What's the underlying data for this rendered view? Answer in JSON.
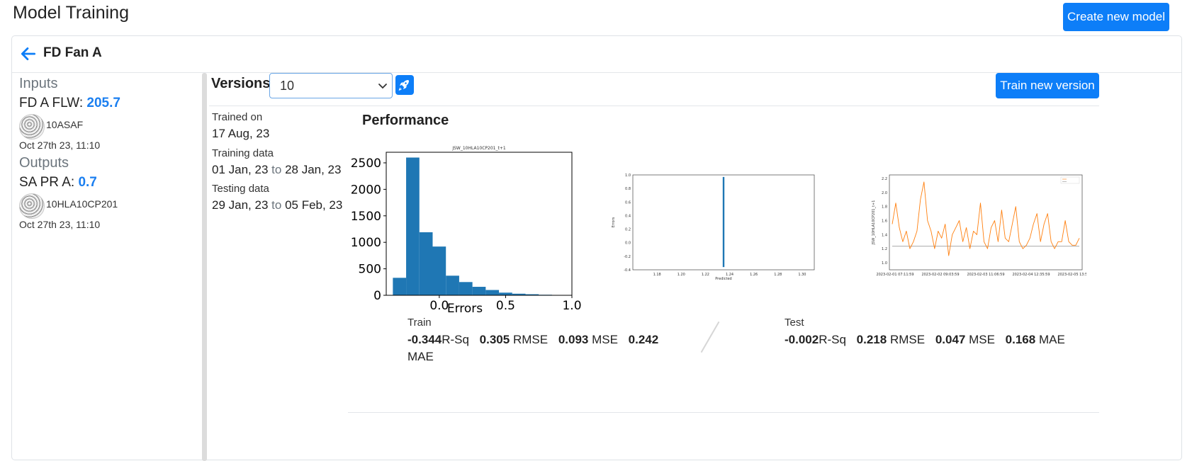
{
  "page": {
    "title": "Model Training",
    "create_button": "Create new model"
  },
  "model": {
    "name": "FD Fan A"
  },
  "inputs": {
    "section_title": "Inputs",
    "label": "FD A FLW:",
    "value": "205.7",
    "tag": "10ASAF",
    "timestamp": "Oct 27th 23, 11:10"
  },
  "outputs": {
    "section_title": "Outputs",
    "label": "SA PR A:",
    "value": "0.7",
    "tag": "10HLA10CP201",
    "timestamp": "Oct 27th 23, 11:10"
  },
  "versions": {
    "label": "Versions :",
    "selected": "10",
    "train_button": "Train new version"
  },
  "details": {
    "trained_on_label": "Trained on",
    "trained_on_value": "17 Aug, 23",
    "training_label": "Training data",
    "training_from": "01 Jan, 23",
    "training_to": "28 Jan, 23",
    "testing_label": "Testing data",
    "testing_from": "29 Jan, 23",
    "testing_to": "05 Feb, 23",
    "to_word": "to"
  },
  "performance": {
    "title": "Performance",
    "train": {
      "title": "Train",
      "rsq": "-0.344",
      "rsq_label": "R-Sq",
      "rmse": "0.305",
      "rmse_label": "RMSE",
      "mse": "0.093",
      "mse_label": "MSE",
      "mae": "0.242",
      "mae_label": "MAE"
    },
    "test": {
      "title": "Test",
      "rsq": "-0.002",
      "rsq_label": "R-Sq",
      "rmse": "0.218",
      "rmse_label": "RMSE",
      "mse": "0.047",
      "mse_label": "MSE",
      "mae": "0.168",
      "mae_label": "MAE"
    }
  },
  "chart_data": [
    {
      "type": "bar",
      "title": "JSW_10HLA10CP201_t+1",
      "xlabel": "Errors",
      "ylabel": "",
      "bin_edges": [
        -0.35,
        -0.25,
        -0.15,
        -0.05,
        0.05,
        0.15,
        0.25,
        0.35,
        0.45,
        0.55,
        0.65,
        0.75,
        0.85,
        0.95
      ],
      "values": [
        330,
        2600,
        1190,
        920,
        370,
        250,
        160,
        100,
        50,
        30,
        20,
        10,
        5
      ],
      "xlim": [
        -0.4,
        1.0
      ],
      "ylim": [
        0,
        2700
      ],
      "xticks": [
        "0.0",
        "0.5",
        "1.0"
      ],
      "yticks": [
        "0",
        "500",
        "1000",
        "1500",
        "2000",
        "2500"
      ],
      "color": "#1f77b4"
    },
    {
      "type": "scatter",
      "title": "",
      "xlabel": "Predicted",
      "ylabel": "Errors",
      "xlim": [
        1.16,
        1.31
      ],
      "ylim": [
        -0.4,
        1.0
      ],
      "xticks": [
        "1.18",
        "1.20",
        "1.22",
        "1.24",
        "1.26",
        "1.28",
        "1.30"
      ],
      "yticks": [
        "-0.4",
        "-0.2",
        "0.0",
        "0.2",
        "0.4",
        "0.6",
        "0.8",
        "1.0"
      ],
      "x_value": 1.235,
      "y_range": [
        -0.36,
        0.97
      ],
      "color": "#1f77b4"
    },
    {
      "type": "line",
      "title": "",
      "xlabel": "",
      "ylabel": "JSW_10HLA10CP201_t+1",
      "ylim": [
        0.9,
        2.25
      ],
      "yticks": [
        "1.0",
        "1.2",
        "1.4",
        "1.6",
        "1.8",
        "2.0",
        "2.2"
      ],
      "xticks": [
        "2023-02-01 07:11:59",
        "2023-02-02 09:03:59",
        "2023-02-03 11:06:59",
        "2023-02-04 12:35:59",
        "2023-02-05 13:57:59"
      ],
      "series": [
        {
          "values": [
            1.55,
            1.85,
            1.5,
            1.3,
            1.45,
            1.2,
            1.3,
            1.45,
            1.9,
            2.15,
            1.6,
            1.45,
            1.2,
            1.45,
            1.35,
            1.55,
            1.1,
            1.4,
            1.5,
            1.6,
            1.3,
            1.5,
            1.2,
            1.45,
            1.4,
            1.85,
            1.3,
            1.2,
            1.5,
            1.6,
            1.3,
            1.75,
            1.35,
            1.3,
            1.55,
            1.8,
            1.3,
            1.2,
            1.25,
            1.35,
            1.55,
            1.7,
            1.3,
            1.55,
            1.7,
            1.3,
            1.2,
            1.3,
            1.3,
            1.6,
            1.3,
            1.25,
            1.25,
            1.35
          ],
          "color": "#ff7f0e"
        },
        {
          "values": [
            1.235,
            1.235
          ],
          "color": "#8c8c8c"
        }
      ]
    }
  ]
}
